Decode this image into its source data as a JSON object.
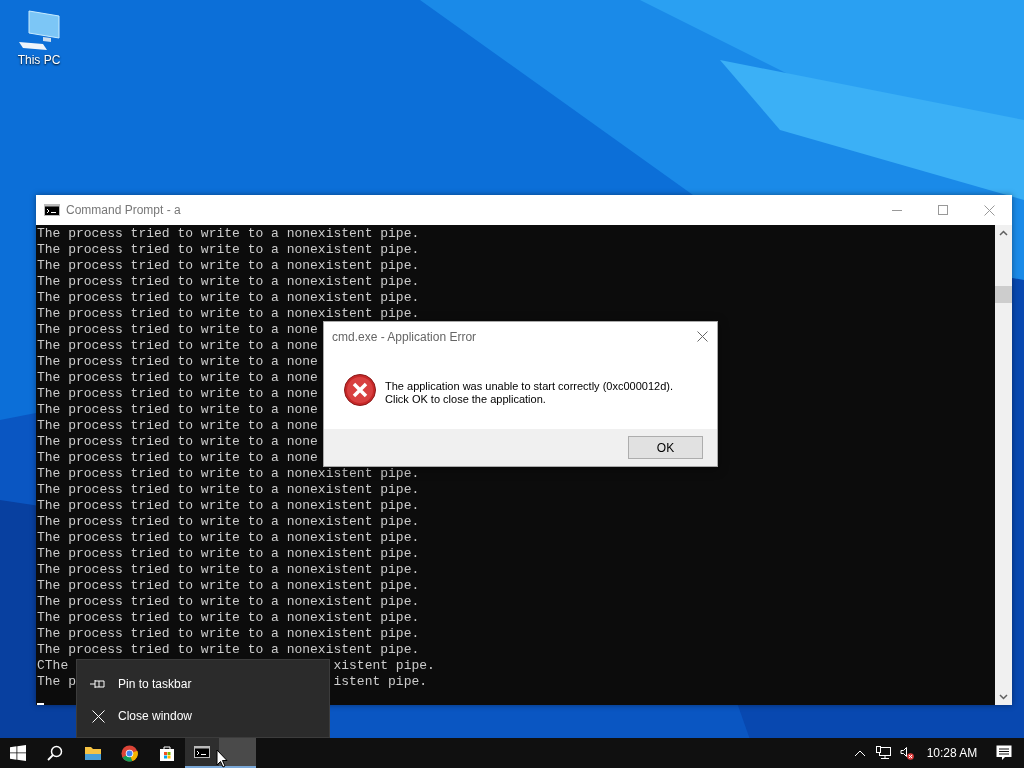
{
  "desktop": {
    "icons": [
      {
        "label": "This PC",
        "kind": "computer"
      }
    ]
  },
  "console_window": {
    "title": "Command Prompt - a",
    "lines": [
      {
        "kind": "plain",
        "text": "The process tried to write to a nonexistent pipe."
      },
      {
        "kind": "plain",
        "text": "The process tried to write to a nonexistent pipe."
      },
      {
        "kind": "plain",
        "text": "The process tried to write to a nonexistent pipe."
      },
      {
        "kind": "plain",
        "text": "The process tried to write to a nonexistent pipe."
      },
      {
        "kind": "plain",
        "text": "The process tried to write to a nonexistent pipe."
      },
      {
        "kind": "plain",
        "text": "The process tried to write to a nonexistent pipe."
      },
      {
        "kind": "plain",
        "text": "The process tried to write to a none"
      },
      {
        "kind": "plain",
        "text": "The process tried to write to a none"
      },
      {
        "kind": "plain",
        "text": "The process tried to write to a none"
      },
      {
        "kind": "plain",
        "text": "The process tried to write to a none"
      },
      {
        "kind": "plain",
        "text": "The process tried to write to a none"
      },
      {
        "kind": "plain",
        "text": "The process tried to write to a none"
      },
      {
        "kind": "plain",
        "text": "The process tried to write to a none"
      },
      {
        "kind": "plain",
        "text": "The process tried to write to a none"
      },
      {
        "kind": "plain",
        "text": "The process tried to write to a none"
      },
      {
        "kind": "plain",
        "text": "The process tried to write to a nonexistent pipe."
      },
      {
        "kind": "plain",
        "text": "The process tried to write to a nonexistent pipe."
      },
      {
        "kind": "plain",
        "text": "The process tried to write to a nonexistent pipe."
      },
      {
        "kind": "plain",
        "text": "The process tried to write to a nonexistent pipe."
      },
      {
        "kind": "plain",
        "text": "The process tried to write to a nonexistent pipe."
      },
      {
        "kind": "plain",
        "text": "The process tried to write to a nonexistent pipe."
      },
      {
        "kind": "plain",
        "text": "The process tried to write to a nonexistent pipe."
      },
      {
        "kind": "plain",
        "text": "The process tried to write to a nonexistent pipe."
      },
      {
        "kind": "plain",
        "text": "The process tried to write to a nonexistent pipe."
      },
      {
        "kind": "plain",
        "text": "The process tried to write to a nonexistent pipe."
      },
      {
        "kind": "plain",
        "text": "The process tried to write to a nonexistent pipe."
      },
      {
        "kind": "plain",
        "text": "The process tried to write to a nonexistent pipe."
      },
      {
        "kind": "split",
        "left": "CThe",
        "right": "xistent pipe."
      },
      {
        "kind": "split",
        "left": "The p",
        "right": "istent pipe."
      }
    ]
  },
  "dialog": {
    "title": "cmd.exe - Application Error",
    "message": [
      "The application was unable to start correctly (0xc000012d).",
      "Click OK to close the application."
    ],
    "button": "OK"
  },
  "context_menu": {
    "items": [
      {
        "kind": "pin",
        "label": "Pin to taskbar"
      },
      {
        "kind": "close",
        "label": "Close window"
      }
    ]
  },
  "taskbar": {
    "apps": [
      {
        "kind": "explorer",
        "active": false
      },
      {
        "kind": "chrome",
        "active": false
      },
      {
        "kind": "store",
        "active": false
      },
      {
        "kind": "cmd",
        "active": true
      }
    ],
    "clock": "10:28 AM"
  }
}
